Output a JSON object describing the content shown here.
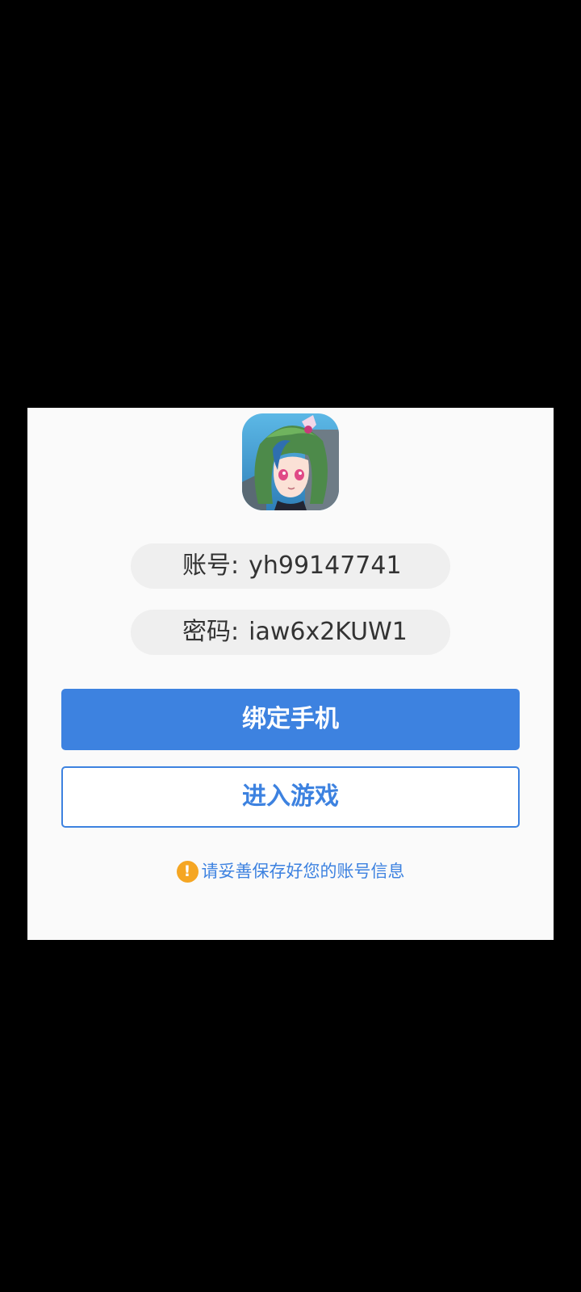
{
  "app": {
    "icon": "game-character-icon"
  },
  "account": {
    "label": "账号:",
    "value": "yh99147741"
  },
  "password": {
    "label": "密码:",
    "value": "iaw6x2KUW1"
  },
  "buttons": {
    "bind_phone": "绑定手机",
    "enter_game": "进入游戏"
  },
  "notice": {
    "icon": "warning-icon",
    "text": "请妥善保存好您的账号信息"
  },
  "colors": {
    "primary": "#3d82e0",
    "warning": "#f5a623",
    "field_bg": "#efefef",
    "dialog_bg": "#fafafa",
    "backdrop": "#000000"
  }
}
